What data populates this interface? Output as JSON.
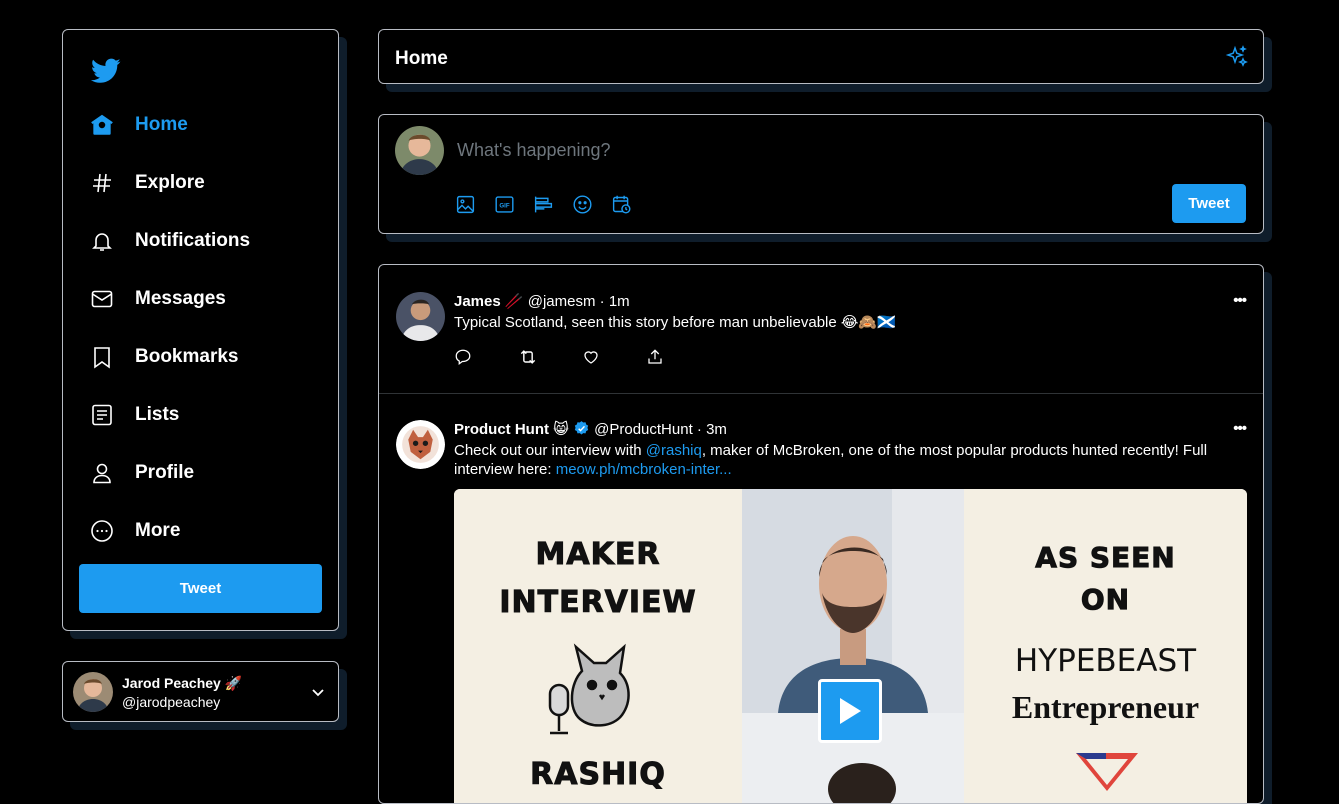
{
  "sidebar": {
    "logo": "twitter-bird-icon",
    "nav": [
      {
        "label": "Home",
        "icon": "home-icon",
        "active": true
      },
      {
        "label": "Explore",
        "icon": "hashtag-icon"
      },
      {
        "label": "Notifications",
        "icon": "bell-icon"
      },
      {
        "label": "Messages",
        "icon": "envelope-icon"
      },
      {
        "label": "Bookmarks",
        "icon": "bookmark-icon"
      },
      {
        "label": "Lists",
        "icon": "list-icon"
      },
      {
        "label": "Profile",
        "icon": "person-icon"
      },
      {
        "label": "More",
        "icon": "more-circle-icon"
      }
    ],
    "tweet_button": "Tweet"
  },
  "account": {
    "name": "Jarod Peachey 🚀",
    "handle": "@jarodpeachey"
  },
  "header": {
    "title": "Home",
    "icon": "sparkle-icon"
  },
  "composer": {
    "placeholder": "What's happening?",
    "tools": [
      "image-icon",
      "gif-icon",
      "poll-icon",
      "emoji-icon",
      "schedule-icon"
    ],
    "tweet_button": "Tweet"
  },
  "feed": [
    {
      "name": "James 🥢",
      "handle": "@jamesm",
      "time": "1m",
      "text": "Typical Scotland, seen this story before man unbelievable 😂🙈🏴󠁧󠁢󠁳󠁣󠁴󠁿",
      "more": "•••"
    },
    {
      "name": "Product Hunt 😸",
      "verified": true,
      "handle": "@ProductHunt",
      "time": "3m",
      "text_before": "Check out our interview with ",
      "mention": "@rashiq",
      "text_after": ", maker of McBroken, one of the most popular products hunted recently! Full interview here: ",
      "link": "meow.ph/mcbroken-inter...",
      "more": "•••",
      "media": {
        "left_line1": "MAKER",
        "left_line2": "INTERVIEW",
        "left_line3": "RASHIQ",
        "right_line1": "AS SEEN",
        "right_line2": "ON",
        "right_line3": "HYPEBEAST",
        "right_line4": "Entrepreneur"
      }
    }
  ],
  "colors": {
    "accent": "#1d9bf0",
    "background": "#000000",
    "border": "#b8bcc4"
  }
}
